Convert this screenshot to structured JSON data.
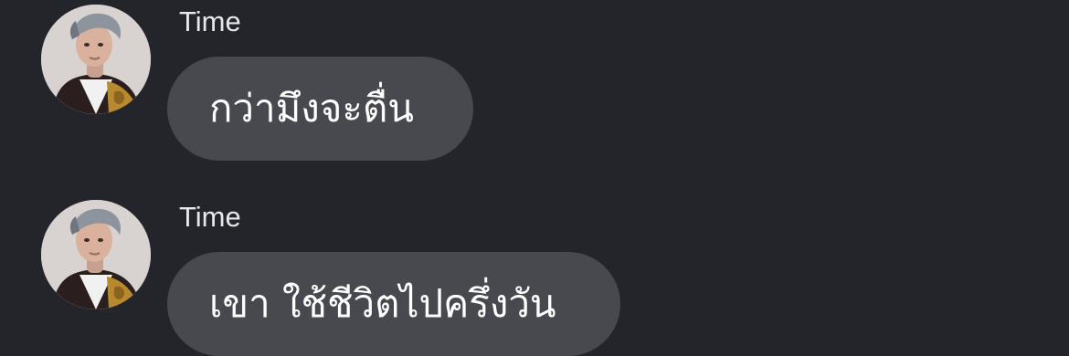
{
  "chat": {
    "messages": [
      {
        "sender": "Time",
        "avatar_icon": "user-avatar-photo-icon",
        "text": "กว่ามึงจะตื่น"
      },
      {
        "sender": "Time",
        "avatar_icon": "user-avatar-photo-icon",
        "text": "เขา ใช้ชีวิตไปครึ่งวัน"
      }
    ]
  },
  "colors": {
    "background": "#24252a",
    "bubble": "#48494f",
    "text": "#ffffff",
    "sender_name": "#e8e8ea"
  }
}
